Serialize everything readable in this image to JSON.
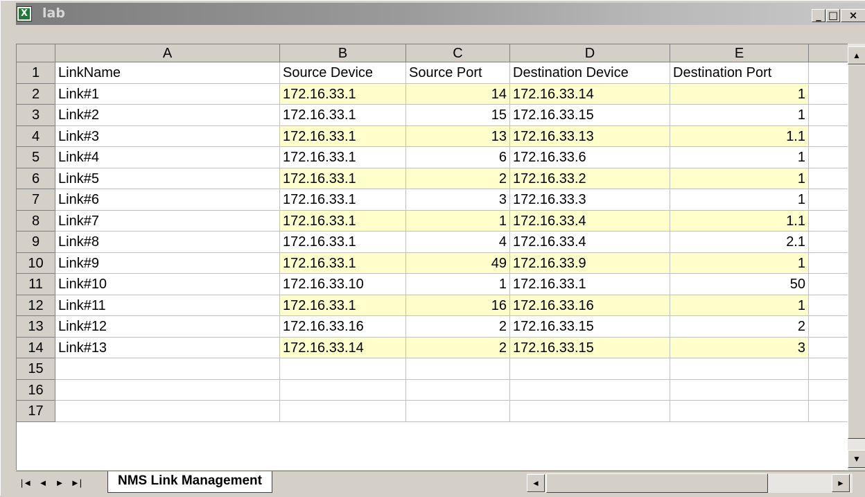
{
  "window": {
    "title": "lab",
    "buttons": {
      "minimize": "_",
      "restore": "□",
      "close": "×"
    }
  },
  "columns": [
    "A",
    "B",
    "C",
    "D",
    "E"
  ],
  "row_numbers": [
    "1",
    "2",
    "3",
    "4",
    "5",
    "6",
    "7",
    "8",
    "9",
    "10",
    "11",
    "12",
    "13",
    "14",
    "15",
    "16",
    "17"
  ],
  "table": {
    "headers": [
      "LinkName",
      "Source Device",
      "Source Port",
      "Destination Device",
      "Destination Port"
    ],
    "rows": [
      [
        "Link#1",
        "172.16.33.1",
        "14",
        "172.16.33.14",
        "1"
      ],
      [
        "Link#2",
        "172.16.33.1",
        "15",
        "172.16.33.15",
        "1"
      ],
      [
        "Link#3",
        "172.16.33.1",
        "13",
        "172.16.33.13",
        "1.1"
      ],
      [
        "Link#4",
        "172.16.33.1",
        "6",
        "172.16.33.6",
        "1"
      ],
      [
        "Link#5",
        "172.16.33.1",
        "2",
        "172.16.33.2",
        "1"
      ],
      [
        "Link#6",
        "172.16.33.1",
        "3",
        "172.16.33.3",
        "1"
      ],
      [
        "Link#7",
        "172.16.33.1",
        "1",
        "172.16.33.4",
        "1.1"
      ],
      [
        "Link#8",
        "172.16.33.1",
        "4",
        "172.16.33.4",
        "2.1"
      ],
      [
        "Link#9",
        "172.16.33.1",
        "49",
        "172.16.33.9",
        "1"
      ],
      [
        "Link#10",
        "172.16.33.10",
        "1",
        "172.16.33.1",
        "50"
      ],
      [
        "Link#11",
        "172.16.33.1",
        "16",
        "172.16.33.16",
        "1"
      ],
      [
        "Link#12",
        "172.16.33.16",
        "2",
        "172.16.33.15",
        "2"
      ],
      [
        "Link#13",
        "172.16.33.14",
        "2",
        "172.16.33.15",
        "3"
      ]
    ]
  },
  "highlight_color": "#ffffcc",
  "sheet_tab": {
    "label": "NMS Link Management"
  },
  "nav": {
    "first": "|◄",
    "prev": "◄",
    "next": "►",
    "last": "►|"
  },
  "scroll": {
    "up": "▲",
    "down": "▼",
    "left": "◄",
    "right": "►"
  }
}
